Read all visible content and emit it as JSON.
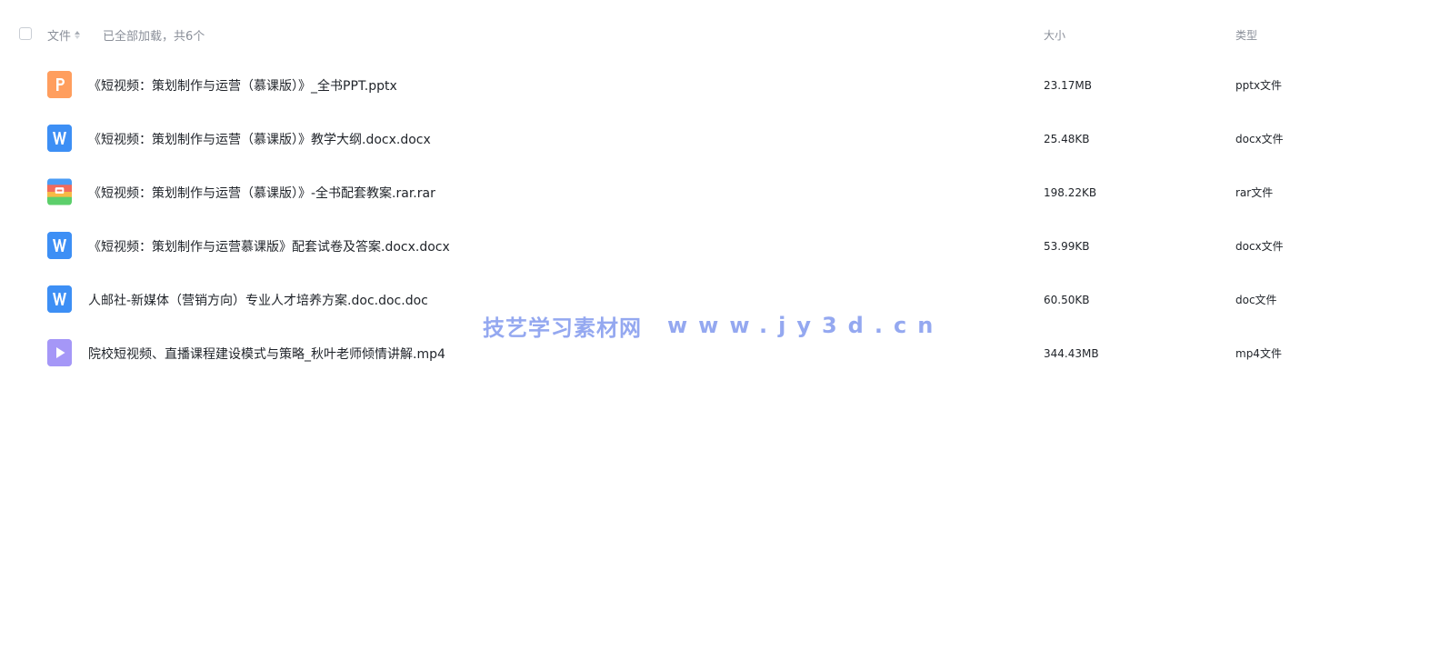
{
  "header": {
    "col_name": "文件",
    "load_status": "已全部加载，共6个",
    "col_size": "大小",
    "col_type": "类型"
  },
  "files": [
    {
      "icon": "ppt-icon",
      "icon_color": "#ff9e5e",
      "name": "《短视频：策划制作与运营（慕课版）》_全书PPT.pptx",
      "size": "23.17MB",
      "type": "pptx文件"
    },
    {
      "icon": "word-icon",
      "icon_color": "#3d8ff5",
      "name": "《短视频：策划制作与运营（慕课版）》教学大纲.docx.docx",
      "size": "25.48KB",
      "type": "docx文件"
    },
    {
      "icon": "rar-icon",
      "icon_color": "#f26b5b",
      "name": "《短视频：策划制作与运营（慕课版）》-全书配套教案.rar.rar",
      "size": "198.22KB",
      "type": "rar文件"
    },
    {
      "icon": "word-icon",
      "icon_color": "#3d8ff5",
      "name": "《短视频：策划制作与运营慕课版》配套试卷及答案.docx.docx",
      "size": "53.99KB",
      "type": "docx文件"
    },
    {
      "icon": "word-icon",
      "icon_color": "#3d8ff5",
      "name": "人邮社-新媒体（营销方向）专业人才培养方案.doc.doc.doc",
      "size": "60.50KB",
      "type": "doc文件"
    },
    {
      "icon": "video-icon",
      "icon_color": "#9b8cf5",
      "name": "院校短视频、直播课程建设模式与策略_秋叶老师倾情讲解.mp4",
      "size": "344.43MB",
      "type": "mp4文件"
    }
  ],
  "watermark": {
    "cn": "技艺学习素材网",
    "url": "www.jy3d.cn",
    "color": "#8fa4f0"
  }
}
